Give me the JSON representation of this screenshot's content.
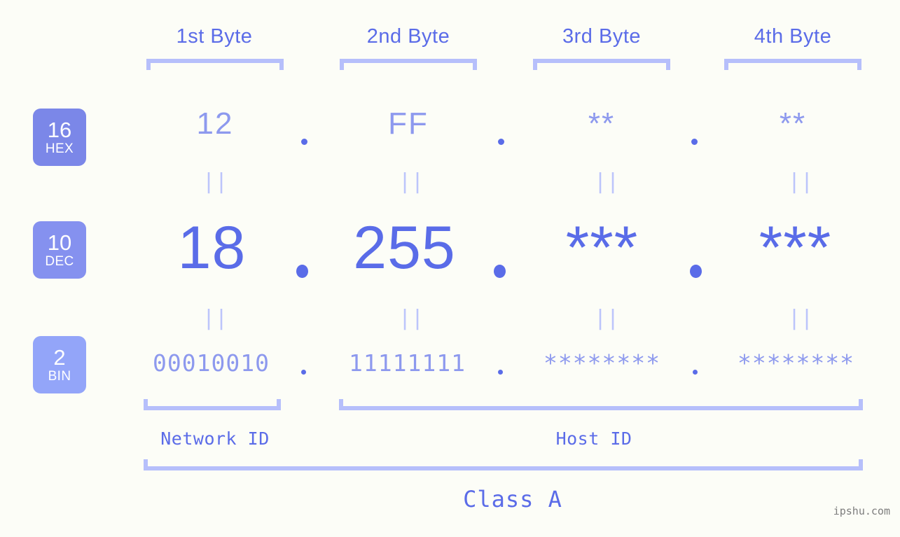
{
  "meta": {
    "background_color": "#fcfdf7",
    "accent_primary": "#5a6ce8",
    "accent_light": "#8d99ee",
    "bracket_color": "#b6bffb",
    "watermark": "ipshu.com"
  },
  "byte_headers": [
    {
      "label": "1st Byte"
    },
    {
      "label": "2nd Byte"
    },
    {
      "label": "3rd Byte"
    },
    {
      "label": "4th Byte"
    }
  ],
  "radix_badges": [
    {
      "number": "16",
      "caption": "HEX",
      "color": "#7b87e8"
    },
    {
      "number": "10",
      "caption": "DEC",
      "color": "#8591ef"
    },
    {
      "number": "2",
      "caption": "BIN",
      "color": "#93a5f9"
    }
  ],
  "rows": {
    "hex": {
      "radix": "16",
      "name": "HEX",
      "values": [
        "12",
        "FF",
        "**",
        "**"
      ],
      "separator": "."
    },
    "dec": {
      "radix": "10",
      "name": "DEC",
      "values": [
        "18",
        "255",
        "***",
        "***"
      ],
      "separator": "."
    },
    "bin": {
      "radix": "2",
      "name": "BIN",
      "values": [
        "00010010",
        "11111111",
        "********",
        "********"
      ],
      "separator": "."
    }
  },
  "equals_marks": {
    "glyph": "||",
    "count_per_row": 4
  },
  "id_sections": [
    {
      "label": "Network ID"
    },
    {
      "label": "Host ID"
    }
  ],
  "class_label": "Class A"
}
